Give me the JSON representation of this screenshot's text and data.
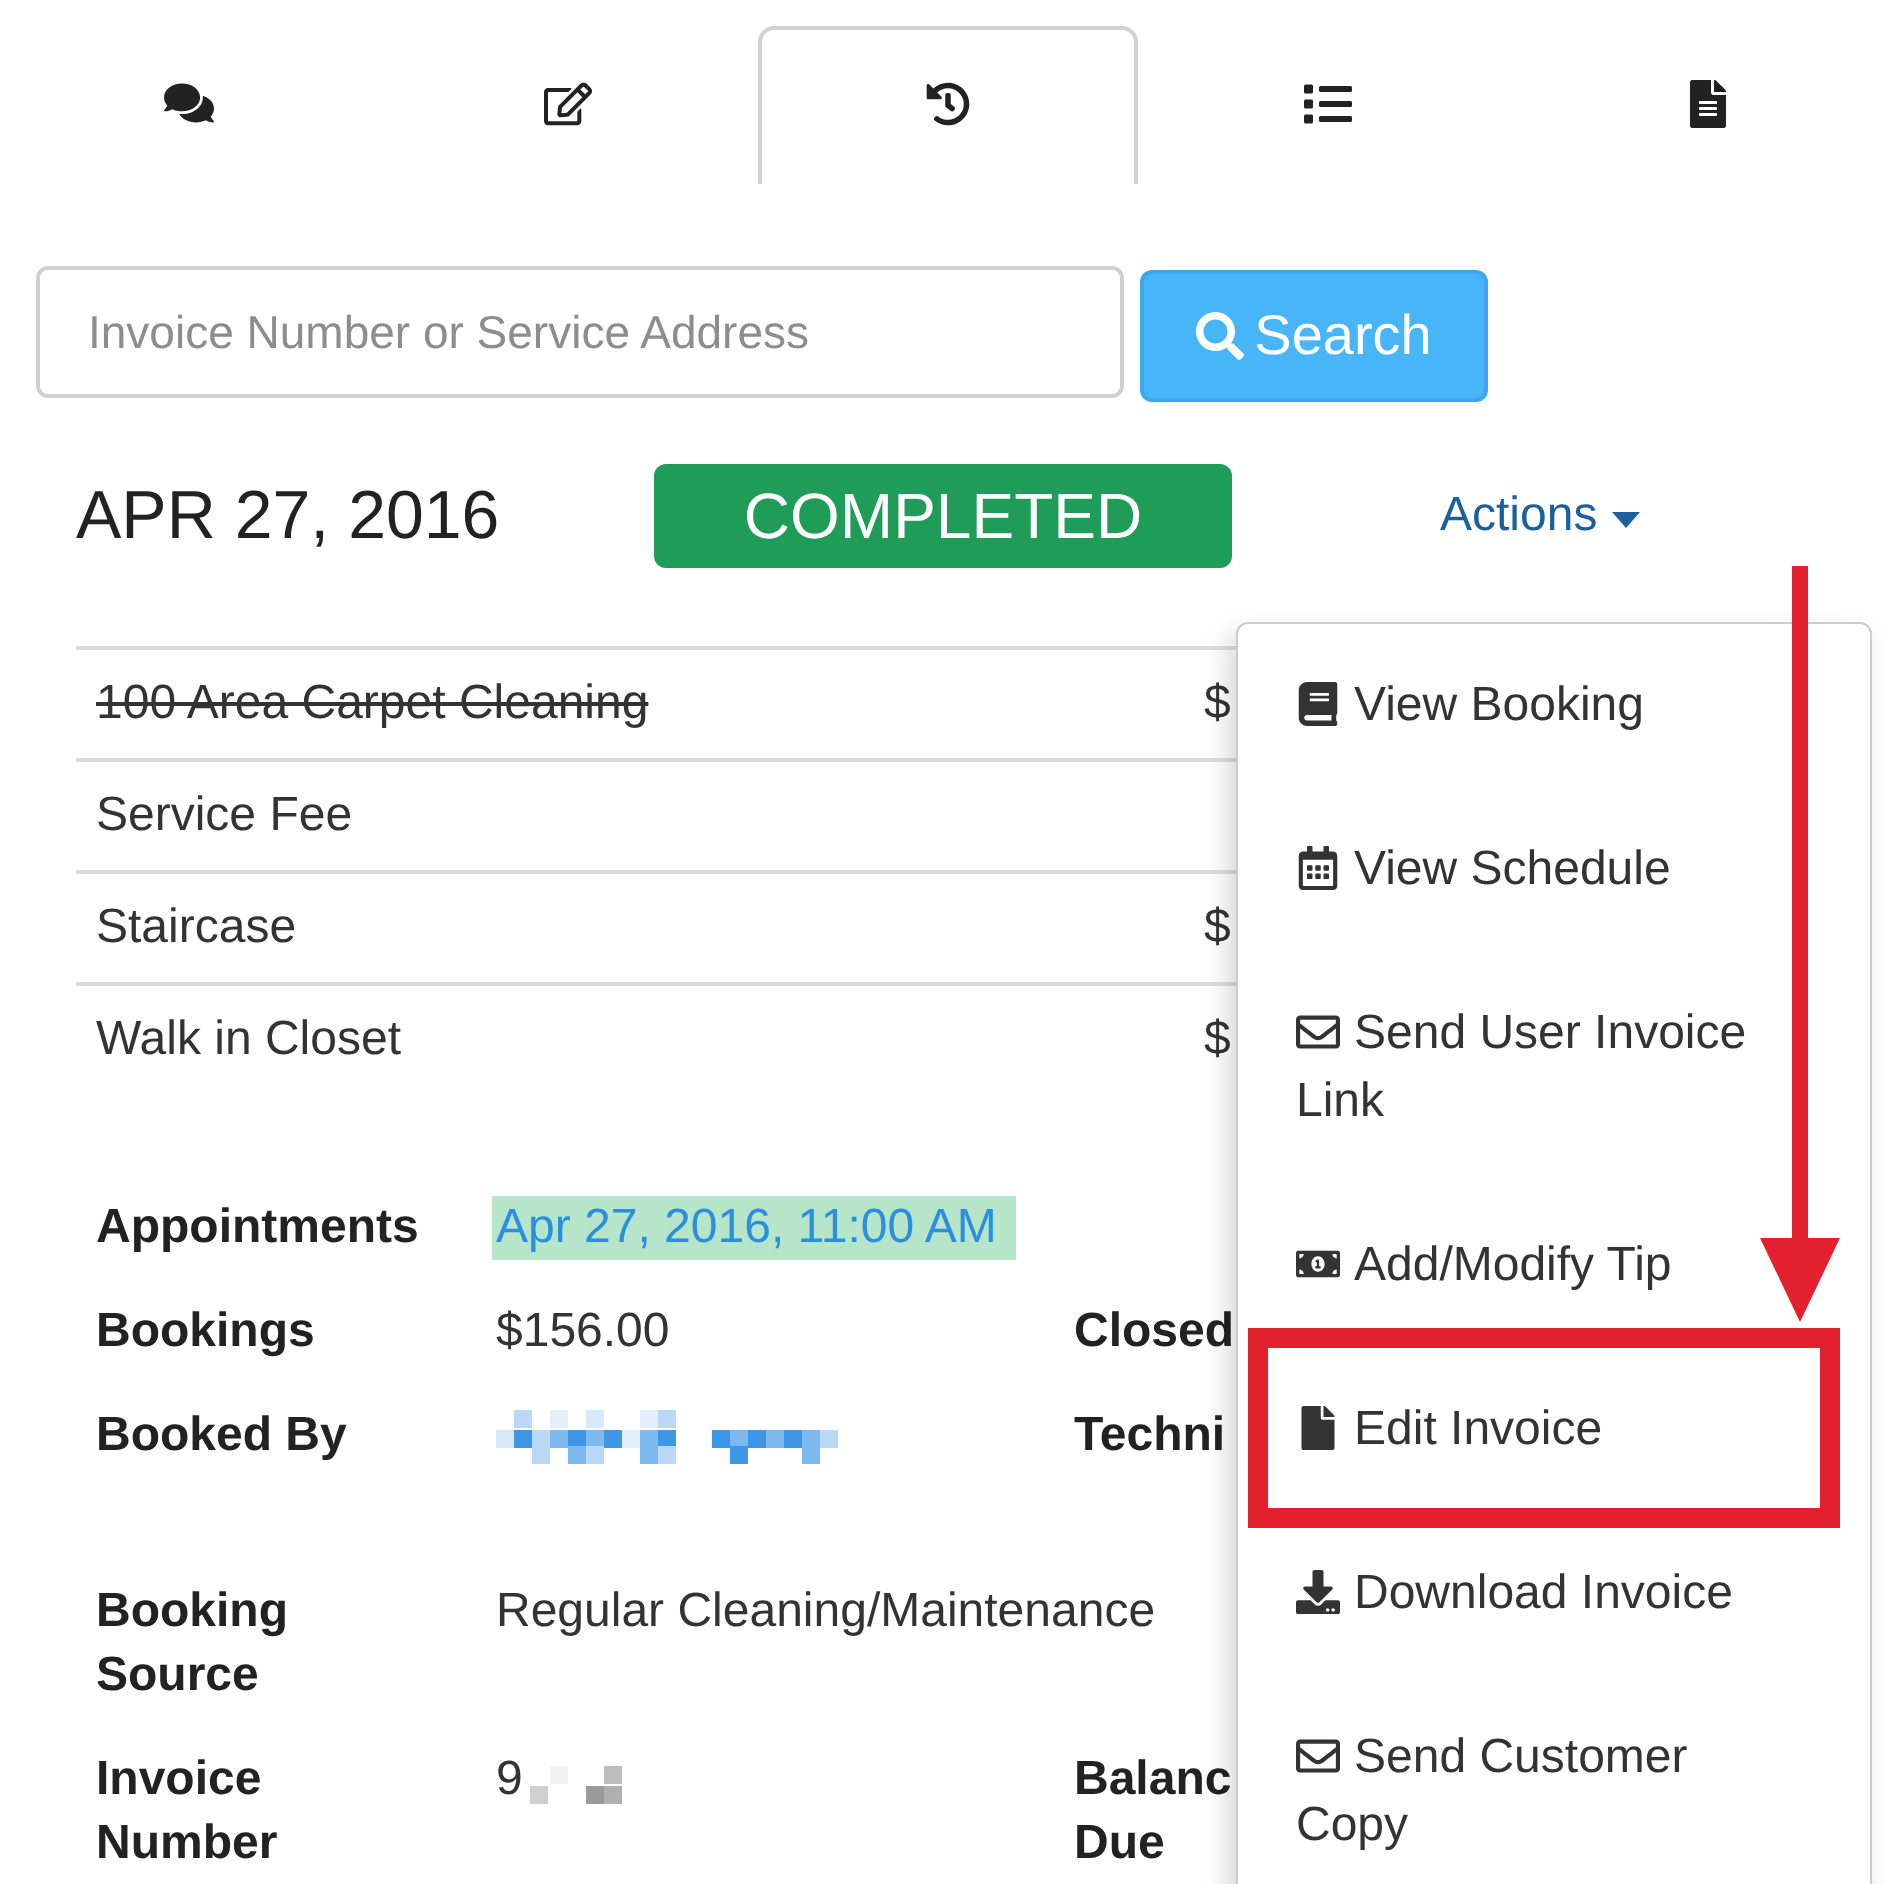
{
  "tabs": [
    {
      "selected": false
    },
    {
      "selected": false
    },
    {
      "selected": true
    },
    {
      "selected": false
    },
    {
      "selected": false
    }
  ],
  "search": {
    "placeholder": "Invoice Number or Service Address",
    "button": "Search"
  },
  "invoice": {
    "date": "APR 27, 2016",
    "status": "COMPLETED"
  },
  "actions": {
    "label": "Actions",
    "expanded": true,
    "items": [
      {
        "label": "View Booking",
        "highlighted": false
      },
      {
        "label": "View Schedule",
        "highlighted": false
      },
      {
        "label": "Send User Invoice Link",
        "highlighted": false
      },
      {
        "label": "Add/Modify Tip",
        "highlighted": false
      },
      {
        "label": "Edit Invoice",
        "highlighted": true
      },
      {
        "label": "Download Invoice",
        "highlighted": false
      },
      {
        "label": "Send Customer Copy",
        "highlighted": false
      }
    ]
  },
  "line_items": [
    {
      "name": "100 Area Carpet Cleaning",
      "amount": "$",
      "struck": true
    },
    {
      "name": "Service Fee",
      "struck": false
    },
    {
      "name": "Staircase",
      "amount": "$",
      "struck": false
    },
    {
      "name": "Walk in Closet",
      "amount": "$",
      "struck": false
    }
  ],
  "details": [
    {
      "label": "Appointments",
      "kind": "link",
      "value": "Apr 27, 2016, 11:00 AM",
      "highlighted": true
    },
    {
      "label": "Bookings",
      "kind": "text",
      "value": "$156.00",
      "side_label": "Closed"
    },
    {
      "label": "Booked By",
      "kind": "redacted",
      "side_label": "Techni"
    },
    {
      "label": "Booking Source",
      "kind": "text",
      "value": "Regular Cleaning/Maintenance"
    },
    {
      "label": "Invoice Number",
      "kind": "partly_redacted",
      "value": "9",
      "side_label": "Balanc Due"
    }
  ]
}
